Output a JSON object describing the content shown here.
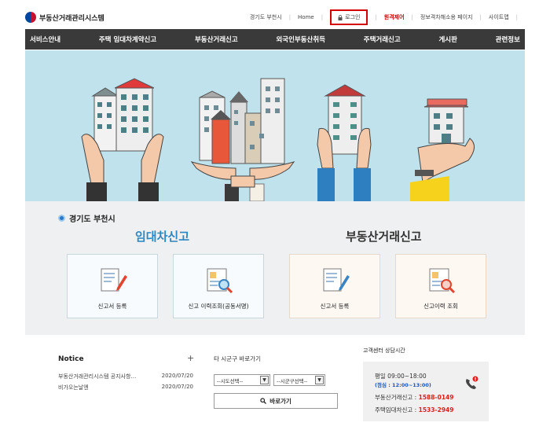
{
  "header": {
    "site_name": "부동산거래관리시스템",
    "utility_links": [
      "경기도 부천시",
      "Home",
      "로그인",
      "원격제어",
      "정보격차해소용 페이지",
      "사이트맵"
    ]
  },
  "nav": {
    "items": [
      "서비스안내",
      "주택 임대차계약신고",
      "부동산거래신고",
      "외국인부동산취득",
      "주택거래신고",
      "게시판",
      "관련정보"
    ]
  },
  "service": {
    "region": "경기도 부천시",
    "lease_title": "임대차신고",
    "trade_title": "부동산거래신고",
    "cards": [
      "신고서 등록",
      "신고 이력조회(공동서명)",
      "신고서 등록",
      "신고이력 조회"
    ]
  },
  "notice": {
    "title": "Notice",
    "plus": "+",
    "items": [
      {
        "title": "부동산거래관리시스템 공지사항…",
        "date": "2020/07/20"
      },
      {
        "title": "비가오는날엔",
        "date": "2020/07/20"
      }
    ]
  },
  "quick": {
    "title": "타 시군구 바로가기",
    "sido_placeholder": "--시도선택--",
    "sigungu_placeholder": "--시군구선택--",
    "go_label": "바로가기"
  },
  "customer_center": {
    "title": "고객센터 상담시간",
    "hours": "평일 09:00~18:00",
    "lunch": "(점심 : 12:00~13:00)",
    "trade_label": "부동산거래신고 :",
    "trade_phone": "1588-0149",
    "lease_label": "주택임대차신고 :",
    "lease_phone": "1533-2949"
  },
  "colors": {
    "nav_bg": "#3a3a3a",
    "banner_bg": "#bfe2ec",
    "accent_blue": "#2b88c6",
    "alert_red": "#e0201b"
  }
}
